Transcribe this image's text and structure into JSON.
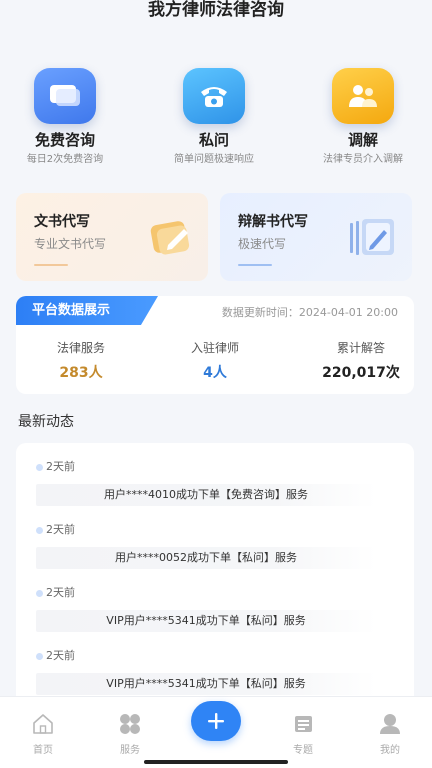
{
  "header": {
    "title": "我方律师法律咨询"
  },
  "services": [
    {
      "name": "免费咨询",
      "desc": "每日2次免费咨询",
      "icon": "chat-bubble-icon"
    },
    {
      "name": "私问",
      "desc": "简单问题极速响应",
      "icon": "telephone-icon"
    },
    {
      "name": "调解",
      "desc": "法律专员介入调解",
      "icon": "mediation-people-icon"
    }
  ],
  "cards": [
    {
      "title": "文书代写",
      "subtitle": "专业文书代写",
      "icon": "document-pen-icon"
    },
    {
      "title": "辩解书代写",
      "subtitle": "极速代写",
      "icon": "edit-document-icon"
    }
  ],
  "stats": {
    "tag": "平台数据展示",
    "updated_label": "数据更新时间：2024-04-01 20:00",
    "items": [
      {
        "label": "法律服务",
        "value": "283人",
        "color": "#c48a2c"
      },
      {
        "label": "入驻律师",
        "value": "4人",
        "color": "#2f7ad8"
      },
      {
        "label": "累计解答",
        "value": "220,017次",
        "color": "#222222"
      }
    ]
  },
  "feed": {
    "title": "最新动态",
    "items": [
      {
        "time": "2天前",
        "message": "用户****4010成功下单【免费咨询】服务"
      },
      {
        "time": "2天前",
        "message": "用户****0052成功下单【私问】服务"
      },
      {
        "time": "2天前",
        "message": "VIP用户****5341成功下单【私问】服务"
      },
      {
        "time": "2天前",
        "message": "VIP用户****5341成功下单【私问】服务"
      }
    ]
  },
  "tabbar": {
    "items": [
      {
        "label": "首页",
        "icon": "home-icon"
      },
      {
        "label": "服务",
        "icon": "grid-icon"
      },
      {
        "label": "专题",
        "icon": "topics-icon"
      },
      {
        "label": "我的",
        "icon": "user-icon"
      }
    ],
    "fab_icon": "plus-icon"
  },
  "colors": {
    "accent": "#2f84f5",
    "consult_icon_bg": "#4b86f0",
    "phone_icon_bg": "#3aa7ee",
    "mediation_icon_bg": "#f6b517"
  }
}
